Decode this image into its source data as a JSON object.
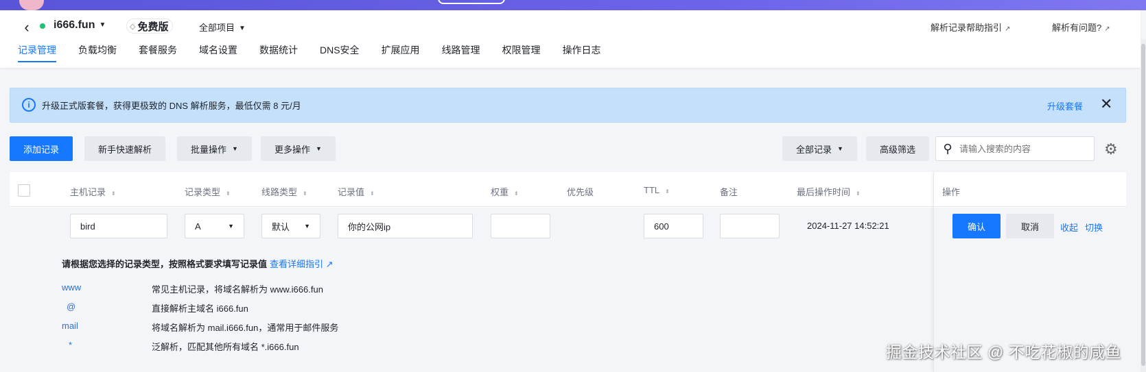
{
  "header": {
    "domain": "i666.fun",
    "plan": "免费版",
    "project": "全部项目",
    "help_links": [
      "解析记录帮助指引",
      "解析有问题?"
    ]
  },
  "tabs": [
    "记录管理",
    "负载均衡",
    "套餐服务",
    "域名设置",
    "数据统计",
    "DNS安全",
    "扩展应用",
    "线路管理",
    "权限管理",
    "操作日志"
  ],
  "notice": {
    "text": "升级正式版套餐，获得更极致的 DNS 解析服务，最低仅需 8 元/月",
    "upgrade_label": "升级套餐"
  },
  "toolbar": {
    "add": "添加记录",
    "quick": "新手快速解析",
    "batch": "批量操作",
    "more": "更多操作",
    "filter_all": "全部记录",
    "advanced": "高级筛选",
    "search_placeholder": "请输入搜索的内容"
  },
  "table": {
    "columns": [
      "主机记录",
      "记录类型",
      "线路类型",
      "记录值",
      "权重",
      "优先级",
      "TTL",
      "备注",
      "最后操作时间",
      "操作"
    ],
    "edit_row": {
      "host": "bird",
      "type": "A",
      "line": "默认",
      "value": "你的公网ip",
      "weight": "",
      "ttl": "600",
      "remark": "",
      "time": "2024-11-27 14:52:21"
    },
    "actions": {
      "confirm": "确认",
      "cancel": "取消",
      "collapse": "收起",
      "switch": "切换"
    }
  },
  "guide": {
    "title": "请根据您选择的记录类型，按照格式要求填写记录值",
    "link": "查看详细指引",
    "examples": [
      {
        "host": "www",
        "desc": "常见主机记录，将域名解析为 www.i666.fun"
      },
      {
        "host": "@",
        "desc": "直接解析主域名 i666.fun"
      },
      {
        "host": "mail",
        "desc": "将域名解析为 mail.i666.fun，通常用于邮件服务"
      },
      {
        "host": "*",
        "desc": "泛解析，匹配其他所有域名 *.i666.fun"
      }
    ]
  },
  "watermark": "掘金技术社区 @ 不吃花椒的咸鱼",
  "colors": {
    "primary": "#1677ff",
    "notice_bg": "#c4e0fb",
    "banner": "#6b63e8",
    "online_dot": "#1fc173"
  }
}
